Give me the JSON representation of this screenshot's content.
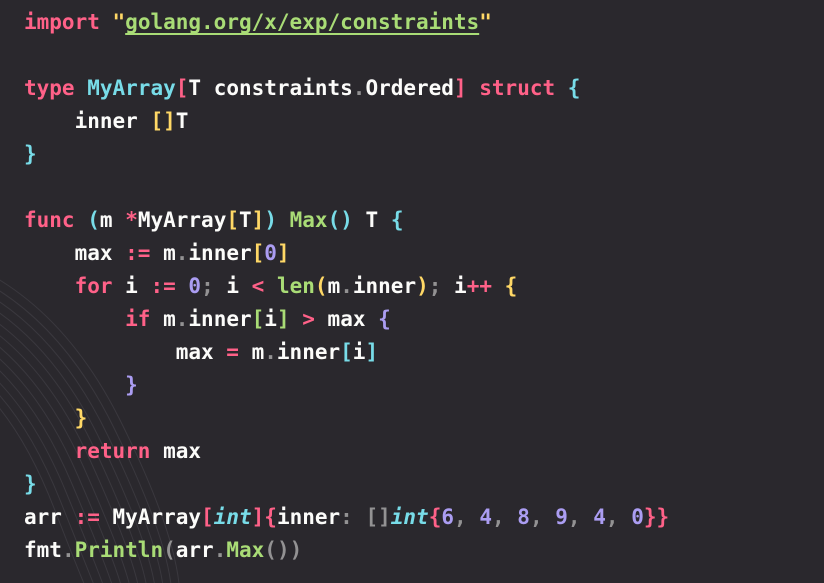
{
  "editor": {
    "language": "go",
    "colors": {
      "background": "#2a282d",
      "keyword": "#ff6188",
      "type": "#78dce8",
      "function": "#a9dc76",
      "number": "#ab9df2",
      "string": "#ffd866",
      "text": "#fcfcfa"
    },
    "lines": [
      [
        [
          "kw",
          "import"
        ],
        [
          "pl",
          " "
        ],
        [
          "str",
          "\""
        ],
        [
          "strl",
          "golang.org/x/exp/constraints"
        ],
        [
          "str",
          "\""
        ]
      ],
      [],
      [
        [
          "kw",
          "type"
        ],
        [
          "pl",
          " "
        ],
        [
          "ty",
          "MyArray"
        ],
        [
          "b2",
          "["
        ],
        [
          "pl",
          "T constraints"
        ],
        [
          "pn",
          "."
        ],
        [
          "pl",
          "Ordered"
        ],
        [
          "b2",
          "]"
        ],
        [
          "pl",
          " "
        ],
        [
          "kw",
          "struct"
        ],
        [
          "pl",
          " "
        ],
        [
          "b1",
          "{"
        ]
      ],
      [
        [
          "pl",
          "    inner "
        ],
        [
          "b3",
          "[]"
        ],
        [
          "pl",
          "T"
        ]
      ],
      [
        [
          "b1",
          "}"
        ]
      ],
      [],
      [
        [
          "kw",
          "func"
        ],
        [
          "pl",
          " "
        ],
        [
          "b1",
          "("
        ],
        [
          "pl",
          "m "
        ],
        [
          "op",
          "*"
        ],
        [
          "pl",
          "MyArray"
        ],
        [
          "b3",
          "["
        ],
        [
          "pl",
          "T"
        ],
        [
          "b3",
          "]"
        ],
        [
          "b1",
          ")"
        ],
        [
          "pl",
          " "
        ],
        [
          "fn",
          "Max"
        ],
        [
          "b1",
          "()"
        ],
        [
          "pl",
          " T "
        ],
        [
          "b1",
          "{"
        ]
      ],
      [
        [
          "pl",
          "    max "
        ],
        [
          "op",
          ":="
        ],
        [
          "pl",
          " m"
        ],
        [
          "pn",
          "."
        ],
        [
          "pl",
          "inner"
        ],
        [
          "b3",
          "["
        ],
        [
          "num",
          "0"
        ],
        [
          "b3",
          "]"
        ]
      ],
      [
        [
          "pl",
          "    "
        ],
        [
          "kw",
          "for"
        ],
        [
          "pl",
          " i "
        ],
        [
          "op",
          ":="
        ],
        [
          "pl",
          " "
        ],
        [
          "num",
          "0"
        ],
        [
          "pn",
          ";"
        ],
        [
          "pl",
          " i "
        ],
        [
          "op",
          "<"
        ],
        [
          "pl",
          " "
        ],
        [
          "fn",
          "len"
        ],
        [
          "b3",
          "("
        ],
        [
          "pl",
          "m"
        ],
        [
          "pn",
          "."
        ],
        [
          "pl",
          "inner"
        ],
        [
          "b3",
          ")"
        ],
        [
          "pn",
          ";"
        ],
        [
          "pl",
          " i"
        ],
        [
          "op",
          "++"
        ],
        [
          "pl",
          " "
        ],
        [
          "b3",
          "{"
        ]
      ],
      [
        [
          "pl",
          "        "
        ],
        [
          "kw",
          "if"
        ],
        [
          "pl",
          " m"
        ],
        [
          "pn",
          "."
        ],
        [
          "pl",
          "inner"
        ],
        [
          "b4",
          "["
        ],
        [
          "pl",
          "i"
        ],
        [
          "b4",
          "]"
        ],
        [
          "pl",
          " "
        ],
        [
          "op",
          ">"
        ],
        [
          "pl",
          " max "
        ],
        [
          "b5",
          "{"
        ]
      ],
      [
        [
          "pl",
          "            max "
        ],
        [
          "op",
          "="
        ],
        [
          "pl",
          " m"
        ],
        [
          "pn",
          "."
        ],
        [
          "pl",
          "inner"
        ],
        [
          "b1",
          "["
        ],
        [
          "pl",
          "i"
        ],
        [
          "b1",
          "]"
        ]
      ],
      [
        [
          "pl",
          "        "
        ],
        [
          "b5",
          "}"
        ]
      ],
      [
        [
          "pl",
          "    "
        ],
        [
          "b3",
          "}"
        ]
      ],
      [
        [
          "pl",
          "    "
        ],
        [
          "kw",
          "return"
        ],
        [
          "pl",
          " max"
        ]
      ],
      [
        [
          "b1",
          "}"
        ]
      ],
      [
        [
          "pl",
          "arr "
        ],
        [
          "op",
          ":="
        ],
        [
          "pl",
          " MyArray"
        ],
        [
          "b2",
          "["
        ],
        [
          "it",
          "int"
        ],
        [
          "b2",
          "]"
        ],
        [
          "b2",
          "{"
        ],
        [
          "pl",
          "inner"
        ],
        [
          "pn",
          ":"
        ],
        [
          "pl",
          " "
        ],
        [
          "pn",
          "[]"
        ],
        [
          "it",
          "int"
        ],
        [
          "b2",
          "{"
        ],
        [
          "num",
          "6"
        ],
        [
          "pn",
          ","
        ],
        [
          "pl",
          " "
        ],
        [
          "num",
          "4"
        ],
        [
          "pn",
          ","
        ],
        [
          "pl",
          " "
        ],
        [
          "num",
          "8"
        ],
        [
          "pn",
          ","
        ],
        [
          "pl",
          " "
        ],
        [
          "num",
          "9"
        ],
        [
          "pn",
          ","
        ],
        [
          "pl",
          " "
        ],
        [
          "num",
          "4"
        ],
        [
          "pn",
          ","
        ],
        [
          "pl",
          " "
        ],
        [
          "num",
          "0"
        ],
        [
          "b2",
          "}}"
        ]
      ],
      [
        [
          "pl",
          "fmt"
        ],
        [
          "pn",
          "."
        ],
        [
          "fn",
          "Println"
        ],
        [
          "pn",
          "("
        ],
        [
          "pl",
          "arr"
        ],
        [
          "pn",
          "."
        ],
        [
          "fn",
          "Max"
        ],
        [
          "pn",
          "())"
        ]
      ]
    ]
  }
}
